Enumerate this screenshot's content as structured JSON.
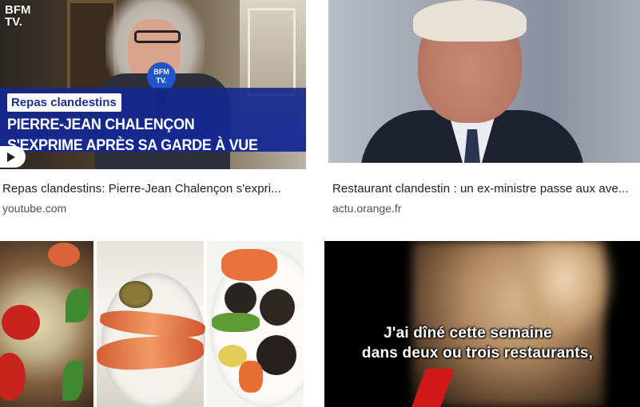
{
  "results": [
    {
      "thumbnail": {
        "channel_logo": [
          "BFM",
          "TV."
        ],
        "mic_logo": [
          "BFM",
          "TV."
        ],
        "tag": "Repas clandestins",
        "headline": [
          "PIERRE-JEAN CHALENÇON",
          "S'EXPRIME APRÈS SA GARDE À VUE"
        ],
        "play_icon": "play-icon"
      },
      "title": "Repas clandestins: Pierre-Jean Chalençon s'expri...",
      "source": "youtube.com"
    },
    {
      "thumbnail": {},
      "title": "Restaurant clandestin : un ex-ministre passe aux ave...",
      "source": "actu.orange.fr"
    },
    {
      "thumbnail": {}
    },
    {
      "thumbnail": {
        "subtitle": [
          "J'ai dîné cette semaine",
          "dans deux ou trois restaurants,"
        ]
      }
    }
  ]
}
